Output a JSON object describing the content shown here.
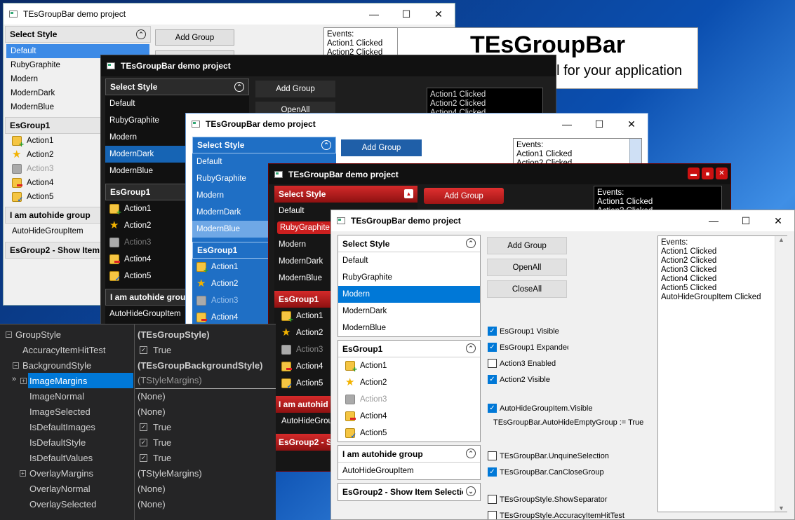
{
  "app_title": "TEsGroupBar demo project",
  "banner": {
    "title": "TEsGroupBar",
    "subtitle": "- The best look and feel for your application"
  },
  "select_style": {
    "header": "Select Style",
    "items": [
      "Default",
      "RubyGraphite",
      "Modern",
      "ModernDark",
      "ModernBlue"
    ]
  },
  "group1": {
    "header": "EsGroup1",
    "items": [
      "Action1",
      "Action2",
      "Action3",
      "Action4",
      "Action5"
    ]
  },
  "autohide_group": {
    "header": "I am autohide group",
    "item": "AutoHideGroupItem"
  },
  "group2_header": "EsGroup2 - Show Item Selection",
  "group2_header_short_1": "EsGroup2 - Show Item S",
  "group2_header_short_2": "EsGroup2 - Sho",
  "autohide_short_red": "I am autohid",
  "autohide_short_dark": "I am autohide grou",
  "autohide_item_short": "AutoHideGroup",
  "buttons": {
    "add_group": "Add Group",
    "open_all": "OpenAll",
    "close_all": "CloseAll"
  },
  "events": {
    "label": "Events:",
    "lines": [
      "Action1 Clicked",
      "Action2 Clicked",
      "Action3 Clicked",
      "Action4 Clicked",
      "Action5 Clicked",
      "AutoHideGroupItem Clicked"
    ],
    "dark_lines": [
      "Action1 Clicked",
      "Action2 Clicked",
      "Action4 Clicked"
    ]
  },
  "checkboxes": [
    {
      "label": "EsGroup1 Visible",
      "checked": true
    },
    {
      "label": "EsGroup1 Expanded",
      "checked": true
    },
    {
      "label": "Action3 Enabled",
      "checked": false
    },
    {
      "label": "Action2 Visible",
      "checked": true
    },
    {
      "label": "AutoHideGroupItem.Visible",
      "checked": true
    },
    {
      "label": "TEsGroupBar.UnquineSelection",
      "checked": false
    },
    {
      "label": "TEsGroupBar.CanCloseGroup",
      "checked": true
    },
    {
      "label": "TEsGroupStyle.ShowSeparator",
      "checked": false
    },
    {
      "label": "TEsGroupStyle.AccuracyItemHitTest",
      "checked": false
    }
  ],
  "autohide_note": "TEsGroupBar.AutoHideEmptyGroup := True",
  "inspector": {
    "rows": [
      {
        "name": "GroupStyle",
        "value": "(TEsGroupStyle)"
      },
      {
        "name": "AccuracyItemHitTest",
        "value": "True"
      },
      {
        "name": "BackgroundStyle",
        "value": "(TEsGroupBackgroundStyle)"
      },
      {
        "name": "ImageMargins",
        "value": "(TStyleMargins)"
      },
      {
        "name": "ImageNormal",
        "value": "(None)"
      },
      {
        "name": "ImageSelected",
        "value": "(None)"
      },
      {
        "name": "IsDefaultImages",
        "value": "True"
      },
      {
        "name": "IsDefaultStyle",
        "value": "True"
      },
      {
        "name": "IsDefaultValues",
        "value": "True"
      },
      {
        "name": "OverlayMargins",
        "value": "(TStyleMargins)"
      },
      {
        "name": "OverlayNormal",
        "value": "(None)"
      },
      {
        "name": "OverlaySelected",
        "value": "(None)"
      }
    ]
  },
  "colors": {
    "win_blue_accent": "#0078d7",
    "ruby_red": "#cc1f1f",
    "modern_blue": "#1f6fc5",
    "dark_bg": "#1e1e1e"
  }
}
